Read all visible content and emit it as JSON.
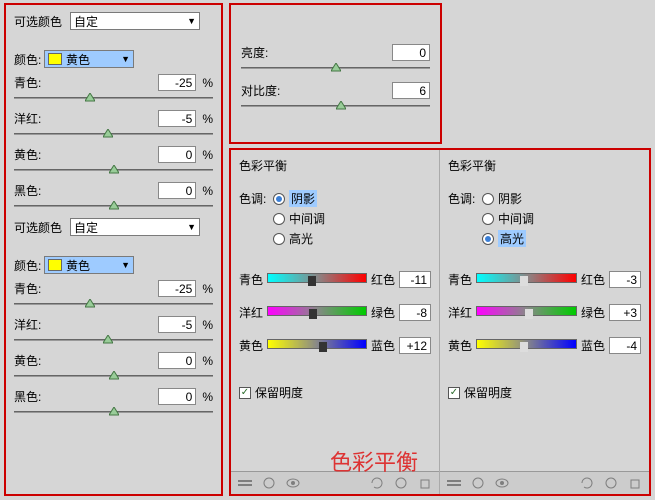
{
  "selcolor": {
    "title": "可选颜色",
    "preset": "自定",
    "colorLabel": "颜色:",
    "yellow": "黄色",
    "pct": "%",
    "ch": {
      "cyan": "青色:",
      "magenta": "洋红:",
      "yellow": "黄色:",
      "black": "黑色:"
    },
    "top": {
      "cyan": "-25",
      "magenta": "-5",
      "yellow": "0",
      "black": "0"
    },
    "bot": {
      "cyan": "-25",
      "magenta": "-5",
      "yellow": "0",
      "black": "0"
    }
  },
  "bc": {
    "brightLabel": "亮度:",
    "bright": "0",
    "contrastLabel": "对比度:",
    "contrast": "6"
  },
  "cb": {
    "title": "色彩平衡",
    "toneLabel": "色调:",
    "opts": {
      "shadow": "阴影",
      "mid": "中间调",
      "hi": "高光"
    },
    "pairs": {
      "cr": {
        "l": "青色",
        "r": "红色"
      },
      "mg": {
        "l": "洋红",
        "r": "绿色"
      },
      "yb": {
        "l": "黄色",
        "r": "蓝色"
      }
    },
    "preserve": "保留明度",
    "left": {
      "cr": "-11",
      "mg": "-8",
      "yb": "+12"
    },
    "right": {
      "cr": "-3",
      "mg": "+3",
      "yb": "-4"
    }
  },
  "annotation": "色彩平衡"
}
